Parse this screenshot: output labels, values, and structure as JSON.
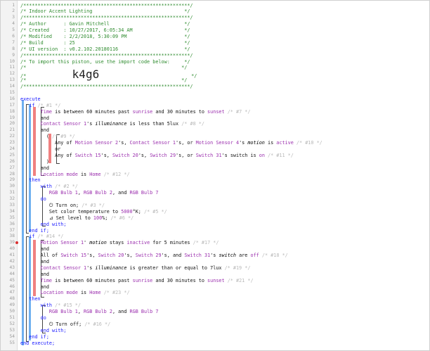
{
  "piston": {
    "lines": [
      {
        "n": "1",
        "segs": [
          {
            "c": "c-com",
            "t": "/**********************************************************/"
          }
        ]
      },
      {
        "n": "2",
        "segs": [
          {
            "c": "c-com",
            "t": "/* Indoor Accent Lighting                                */"
          }
        ]
      },
      {
        "n": "3",
        "segs": [
          {
            "c": "c-com",
            "t": "/**********************************************************/"
          }
        ]
      },
      {
        "n": "4",
        "segs": [
          {
            "c": "c-com",
            "t": "/* Author      : Gavin Mitchell                          */"
          }
        ]
      },
      {
        "n": "5",
        "segs": [
          {
            "c": "c-com",
            "t": "/* Created     : 10/27/2017, 6:05:34 AM                  */"
          }
        ]
      },
      {
        "n": "6",
        "segs": [
          {
            "c": "c-com",
            "t": "/* Modified    : 2/2/2018, 5:30:09 PM                    */"
          }
        ]
      },
      {
        "n": "7",
        "segs": [
          {
            "c": "c-com",
            "t": "/* Build       : 25                                      */"
          }
        ]
      },
      {
        "n": "8",
        "segs": [
          {
            "c": "c-com",
            "t": "/* UI version  : v0.2.102.20180116                       */"
          }
        ]
      },
      {
        "n": "9",
        "segs": [
          {
            "c": "c-com",
            "t": "/**********************************************************/"
          }
        ]
      },
      {
        "n": "10",
        "segs": [
          {
            "c": "c-com",
            "t": "/* To import this piston, use the import code below:     */"
          }
        ]
      },
      {
        "n": "11",
        "segs": [
          {
            "c": "c-com",
            "t": "/*                                                      */"
          }
        ]
      },
      {
        "n": "12",
        "segs": [
          {
            "c": "c-com",
            "t": "/*                "
          },
          {
            "c": "c-import",
            "t": "k4g6"
          },
          {
            "c": "c-com",
            "t": "                                */"
          }
        ]
      },
      {
        "n": "13",
        "segs": [
          {
            "c": "c-com",
            "t": "/*                                                      */"
          }
        ]
      },
      {
        "n": "14",
        "segs": [
          {
            "c": "c-com",
            "t": "/**********************************************************/"
          }
        ]
      },
      {
        "n": "15",
        "segs": []
      },
      {
        "n": "16",
        "segs": [
          {
            "c": "c-kw",
            "t": "execute"
          }
        ]
      },
      {
        "n": "17",
        "segs": [
          {
            "c": "c-str",
            "t": "   "
          },
          {
            "c": "c-kw",
            "t": "if"
          },
          {
            "c": "c-cm",
            "t": " /* #1 */"
          }
        ]
      },
      {
        "n": "18",
        "segs": [
          {
            "c": "c-str",
            "t": "       "
          },
          {
            "c": "c-var",
            "t": "Time"
          },
          {
            "c": "c-op",
            "t": " is between "
          },
          {
            "c": "c-num",
            "t": "60 minutes"
          },
          {
            "c": "c-op",
            "t": " past "
          },
          {
            "c": "c-var",
            "t": "sunrise"
          },
          {
            "c": "c-op",
            "t": " and "
          },
          {
            "c": "c-num",
            "t": "30 minutes"
          },
          {
            "c": "c-op",
            "t": " to "
          },
          {
            "c": "c-var",
            "t": "sunset"
          },
          {
            "c": "c-cm",
            "t": " /* #7 */"
          }
        ]
      },
      {
        "n": "19",
        "segs": [
          {
            "c": "c-str",
            "t": "       "
          },
          {
            "c": "c-op",
            "t": "and"
          }
        ]
      },
      {
        "n": "20",
        "segs": [
          {
            "c": "c-str",
            "t": "       "
          },
          {
            "c": "c-var",
            "t": "Contact Sensor 1"
          },
          {
            "c": "c-op",
            "t": "'s "
          },
          {
            "c": "c-it",
            "t": "illuminance"
          },
          {
            "c": "c-op",
            "t": " is less than "
          },
          {
            "c": "c-num",
            "t": "5lux"
          },
          {
            "c": "c-cm",
            "t": " /* #8 */"
          }
        ]
      },
      {
        "n": "21",
        "segs": [
          {
            "c": "c-str",
            "t": "       "
          },
          {
            "c": "c-op",
            "t": "and"
          }
        ]
      },
      {
        "n": "22",
        "segs": [
          {
            "c": "c-str",
            "t": "         "
          },
          {
            "c": "c-op",
            "t": "("
          },
          {
            "c": "c-cm",
            "t": " /* #9 */"
          }
        ]
      },
      {
        "n": "23",
        "segs": [
          {
            "c": "c-str",
            "t": "            "
          },
          {
            "c": "c-op",
            "t": "Any of "
          },
          {
            "c": "c-var",
            "t": "Motion Sensor 2"
          },
          {
            "c": "c-op",
            "t": "'s, "
          },
          {
            "c": "c-var",
            "t": "Contact Sensor 1"
          },
          {
            "c": "c-op",
            "t": "'s, or "
          },
          {
            "c": "c-var",
            "t": "Motion Sensor 4"
          },
          {
            "c": "c-op",
            "t": "'s "
          },
          {
            "c": "c-it",
            "t": "motion"
          },
          {
            "c": "c-op",
            "t": " is "
          },
          {
            "c": "c-var",
            "t": "active"
          },
          {
            "c": "c-cm",
            "t": " /* #10 */"
          }
        ]
      },
      {
        "n": "24",
        "segs": [
          {
            "c": "c-str",
            "t": "            "
          },
          {
            "c": "c-op",
            "t": "or"
          }
        ]
      },
      {
        "n": "25",
        "segs": [
          {
            "c": "c-str",
            "t": "            "
          },
          {
            "c": "c-op",
            "t": "Any of "
          },
          {
            "c": "c-var",
            "t": "Switch 15"
          },
          {
            "c": "c-op",
            "t": "'s, "
          },
          {
            "c": "c-var",
            "t": "Switch 20"
          },
          {
            "c": "c-op",
            "t": "'s, "
          },
          {
            "c": "c-var",
            "t": "Switch 29"
          },
          {
            "c": "c-op",
            "t": "'s, or "
          },
          {
            "c": "c-var",
            "t": "Switch 31"
          },
          {
            "c": "c-op",
            "t": "'s switch is "
          },
          {
            "c": "c-var",
            "t": "on"
          },
          {
            "c": "c-cm",
            "t": " /* #11 */"
          }
        ]
      },
      {
        "n": "26",
        "segs": [
          {
            "c": "c-str",
            "t": "         "
          },
          {
            "c": "c-op",
            "t": ")"
          }
        ]
      },
      {
        "n": "27",
        "segs": [
          {
            "c": "c-str",
            "t": "       "
          },
          {
            "c": "c-op",
            "t": "and"
          }
        ]
      },
      {
        "n": "28",
        "segs": [
          {
            "c": "c-str",
            "t": "       "
          },
          {
            "c": "c-var",
            "t": "Location mode"
          },
          {
            "c": "c-op",
            "t": " is "
          },
          {
            "c": "c-var",
            "t": "Home"
          },
          {
            "c": "c-cm",
            "t": " /* #12 */"
          }
        ]
      },
      {
        "n": "29",
        "segs": [
          {
            "c": "c-str",
            "t": "   "
          },
          {
            "c": "c-kw",
            "t": "then"
          }
        ]
      },
      {
        "n": "30",
        "segs": [
          {
            "c": "c-str",
            "t": "       "
          },
          {
            "c": "c-kw",
            "t": "with"
          },
          {
            "c": "c-cm",
            "t": " /* #2 */"
          }
        ]
      },
      {
        "n": "31",
        "segs": [
          {
            "c": "c-str",
            "t": "          "
          },
          {
            "c": "c-var",
            "t": "RGB Bulb 1"
          },
          {
            "c": "c-op",
            "t": ", "
          },
          {
            "c": "c-var",
            "t": "RGB Bulb 2"
          },
          {
            "c": "c-op",
            "t": ", and "
          },
          {
            "c": "c-var",
            "t": "RGB Bulb 7"
          }
        ]
      },
      {
        "n": "32",
        "segs": [
          {
            "c": "c-str",
            "t": "       "
          },
          {
            "c": "c-kw",
            "t": "do"
          }
        ]
      },
      {
        "n": "33",
        "segs": [
          {
            "c": "c-str",
            "t": "          "
          },
          {
            "c": "c-op",
            "t": "⏻ Turn on;"
          },
          {
            "c": "c-cm",
            "t": " /* #3 */"
          }
        ]
      },
      {
        "n": "34",
        "segs": [
          {
            "c": "c-str",
            "t": "          "
          },
          {
            "c": "c-op",
            "t": "Set color temperature to "
          },
          {
            "c": "c-var",
            "t": "5000"
          },
          {
            "c": "c-op",
            "t": "°K;"
          },
          {
            "c": "c-cm",
            "t": " /* #5 */"
          }
        ]
      },
      {
        "n": "35",
        "segs": [
          {
            "c": "c-str",
            "t": "          "
          },
          {
            "c": "c-op",
            "t": "⊿ Set level to "
          },
          {
            "c": "c-var",
            "t": "100"
          },
          {
            "c": "c-op",
            "t": "%;"
          },
          {
            "c": "c-cm",
            "t": " /* #6 */"
          }
        ]
      },
      {
        "n": "36",
        "segs": [
          {
            "c": "c-str",
            "t": "       "
          },
          {
            "c": "c-kw",
            "t": "end with;"
          }
        ]
      },
      {
        "n": "37",
        "segs": [
          {
            "c": "c-str",
            "t": "   "
          },
          {
            "c": "c-kw",
            "t": "end if;"
          }
        ]
      },
      {
        "n": "38",
        "segs": [
          {
            "c": "c-str",
            "t": "   "
          },
          {
            "c": "c-kw",
            "t": "if"
          },
          {
            "c": "c-cm",
            "t": " /* #14 */"
          }
        ]
      },
      {
        "n": "39",
        "segs": [
          {
            "c": "c-str",
            "t": "       "
          },
          {
            "c": "c-var",
            "t": "Motion Sensor 1"
          },
          {
            "c": "c-op",
            "t": "' "
          },
          {
            "c": "c-it",
            "t": "motion"
          },
          {
            "c": "c-op",
            "t": " stays "
          },
          {
            "c": "c-var",
            "t": "inactive"
          },
          {
            "c": "c-op",
            "t": " for "
          },
          {
            "c": "c-num",
            "t": "5 minutes"
          },
          {
            "c": "c-cm",
            "t": " /* #17 */"
          }
        ]
      },
      {
        "n": "40",
        "segs": [
          {
            "c": "c-str",
            "t": "       "
          },
          {
            "c": "c-op",
            "t": "and"
          }
        ]
      },
      {
        "n": "41",
        "segs": [
          {
            "c": "c-str",
            "t": "       "
          },
          {
            "c": "c-op",
            "t": "All of "
          },
          {
            "c": "c-var",
            "t": "Switch 15"
          },
          {
            "c": "c-op",
            "t": "'s, "
          },
          {
            "c": "c-var",
            "t": "Switch 20"
          },
          {
            "c": "c-op",
            "t": "'s, "
          },
          {
            "c": "c-var",
            "t": "Switch 29"
          },
          {
            "c": "c-op",
            "t": "'s, and "
          },
          {
            "c": "c-var",
            "t": "Switch 31"
          },
          {
            "c": "c-op",
            "t": "'s "
          },
          {
            "c": "c-it",
            "t": "switch"
          },
          {
            "c": "c-op",
            "t": " are "
          },
          {
            "c": "c-var",
            "t": "off"
          },
          {
            "c": "c-cm",
            "t": " /* #18 */"
          }
        ]
      },
      {
        "n": "42",
        "segs": [
          {
            "c": "c-str",
            "t": "       "
          },
          {
            "c": "c-op",
            "t": "and"
          }
        ]
      },
      {
        "n": "43",
        "segs": [
          {
            "c": "c-str",
            "t": "       "
          },
          {
            "c": "c-var",
            "t": "Contact Sensor 1"
          },
          {
            "c": "c-op",
            "t": "'s "
          },
          {
            "c": "c-it",
            "t": "illuminance"
          },
          {
            "c": "c-op",
            "t": " is greater than or equal to "
          },
          {
            "c": "c-num",
            "t": "7lux"
          },
          {
            "c": "c-cm",
            "t": " /* #19 */"
          }
        ]
      },
      {
        "n": "44",
        "segs": [
          {
            "c": "c-str",
            "t": "       "
          },
          {
            "c": "c-op",
            "t": "and"
          }
        ]
      },
      {
        "n": "45",
        "segs": [
          {
            "c": "c-str",
            "t": "       "
          },
          {
            "c": "c-var",
            "t": "Time"
          },
          {
            "c": "c-op",
            "t": " is between "
          },
          {
            "c": "c-num",
            "t": "60 minutes"
          },
          {
            "c": "c-op",
            "t": " past "
          },
          {
            "c": "c-var",
            "t": "sunrise"
          },
          {
            "c": "c-op",
            "t": " and "
          },
          {
            "c": "c-num",
            "t": "30 minutes"
          },
          {
            "c": "c-op",
            "t": " to "
          },
          {
            "c": "c-var",
            "t": "sunset"
          },
          {
            "c": "c-cm",
            "t": " /* #21 */"
          }
        ]
      },
      {
        "n": "46",
        "segs": [
          {
            "c": "c-str",
            "t": "       "
          },
          {
            "c": "c-op",
            "t": "and"
          }
        ]
      },
      {
        "n": "47",
        "segs": [
          {
            "c": "c-str",
            "t": "       "
          },
          {
            "c": "c-var",
            "t": "Location mode"
          },
          {
            "c": "c-op",
            "t": " is "
          },
          {
            "c": "c-var",
            "t": "Home"
          },
          {
            "c": "c-cm",
            "t": " /* #23 */"
          }
        ]
      },
      {
        "n": "48",
        "segs": [
          {
            "c": "c-str",
            "t": "   "
          },
          {
            "c": "c-kw",
            "t": "then"
          }
        ]
      },
      {
        "n": "49",
        "segs": [
          {
            "c": "c-str",
            "t": "       "
          },
          {
            "c": "c-kw",
            "t": "with"
          },
          {
            "c": "c-cm",
            "t": " /* #15 */"
          }
        ]
      },
      {
        "n": "50",
        "segs": [
          {
            "c": "c-str",
            "t": "          "
          },
          {
            "c": "c-var",
            "t": "RGB Bulb 1"
          },
          {
            "c": "c-op",
            "t": ", "
          },
          {
            "c": "c-var",
            "t": "RGB Bulb 2"
          },
          {
            "c": "c-op",
            "t": ", and "
          },
          {
            "c": "c-var",
            "t": "RGB Bulb 7"
          }
        ]
      },
      {
        "n": "51",
        "segs": [
          {
            "c": "c-str",
            "t": "       "
          },
          {
            "c": "c-kw",
            "t": "do"
          }
        ]
      },
      {
        "n": "52",
        "segs": [
          {
            "c": "c-str",
            "t": "          "
          },
          {
            "c": "c-op",
            "t": "⏻ Turn off;"
          },
          {
            "c": "c-cm",
            "t": " /* #16 */"
          }
        ]
      },
      {
        "n": "53",
        "segs": [
          {
            "c": "c-str",
            "t": "       "
          },
          {
            "c": "c-kw",
            "t": "end with;"
          }
        ]
      },
      {
        "n": "54",
        "segs": [
          {
            "c": "c-str",
            "t": "   "
          },
          {
            "c": "c-kw",
            "t": "end if;"
          }
        ]
      },
      {
        "n": "55",
        "segs": [
          {
            "c": "c-kw",
            "t": "end execute;"
          }
        ]
      }
    ]
  },
  "colors": {
    "comment": "#2e8b2e",
    "keyword": "#1a1aff",
    "variable": "#9b2fae",
    "condition_bar": "#f08080",
    "block_bar": "#6fb0f0"
  }
}
